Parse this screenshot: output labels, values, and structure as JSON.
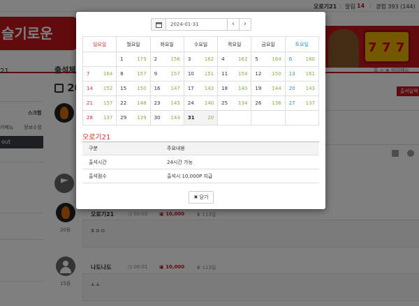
{
  "topbar": {
    "username": "오로기21",
    "alert_label": "알림",
    "alert_count": "14",
    "exp": "경험 393 (144)"
  },
  "banner": {
    "logo_text": "슬기로운"
  },
  "sidebar": {
    "name_fragment": "21",
    "menu_fragment": "스크랩",
    "link1": "키메뉴",
    "link2": "정보수정",
    "logout_fragment": "out",
    "red_fragment": ""
  },
  "page": {
    "title_fragment": "출석체",
    "date_fragment": "20",
    "breadcrumb": "홈 > ★ 마이메뉴",
    "attend_button": "출석달력"
  },
  "entries": [
    {
      "name": "오로기21",
      "time": "00:02",
      "points": "10,000",
      "rank_suffix": "113일",
      "text": "ㅊㅇㅇ",
      "rank": "20등"
    },
    {
      "name": "나도나도",
      "time": "00:01",
      "points": "10,000",
      "rank_suffix": "113일",
      "text": "ㅅㅅ",
      "rank": "15등"
    }
  ],
  "datepicker": {
    "value": "2024-01-31",
    "prev": "‹",
    "next": "›"
  },
  "calendar": {
    "weekdays": [
      "일요일",
      "월요일",
      "화요일",
      "수요일",
      "목요일",
      "금요일",
      "토요일"
    ],
    "weeks": [
      [
        {
          "d": "",
          "c": ""
        },
        {
          "d": "1",
          "c": "173"
        },
        {
          "d": "2",
          "c": "156"
        },
        {
          "d": "3",
          "c": "162"
        },
        {
          "d": "4",
          "c": "162"
        },
        {
          "d": "5",
          "c": "164"
        },
        {
          "d": "6",
          "c": "160"
        }
      ],
      [
        {
          "d": "7",
          "c": "164"
        },
        {
          "d": "8",
          "c": "157"
        },
        {
          "d": "9",
          "c": "157"
        },
        {
          "d": "10",
          "c": "151"
        },
        {
          "d": "11",
          "c": "154"
        },
        {
          "d": "12",
          "c": "150"
        },
        {
          "d": "13",
          "c": "161"
        }
      ],
      [
        {
          "d": "14",
          "c": "152"
        },
        {
          "d": "15",
          "c": "150"
        },
        {
          "d": "16",
          "c": "147"
        },
        {
          "d": "17",
          "c": "143"
        },
        {
          "d": "18",
          "c": "140"
        },
        {
          "d": "19",
          "c": "144"
        },
        {
          "d": "20",
          "c": "143"
        }
      ],
      [
        {
          "d": "21",
          "c": "157"
        },
        {
          "d": "22",
          "c": "148"
        },
        {
          "d": "23",
          "c": "143"
        },
        {
          "d": "24",
          "c": "140"
        },
        {
          "d": "25",
          "c": "134"
        },
        {
          "d": "26",
          "c": "136"
        },
        {
          "d": "27",
          "c": "137"
        }
      ],
      [
        {
          "d": "28",
          "c": "137"
        },
        {
          "d": "29",
          "c": "139"
        },
        {
          "d": "30",
          "c": "144"
        },
        {
          "d": "31",
          "c": "20"
        },
        {
          "d": "",
          "c": ""
        },
        {
          "d": "",
          "c": ""
        },
        {
          "d": "",
          "c": ""
        }
      ]
    ]
  },
  "info": {
    "title": "오로기21",
    "headers": [
      "구분",
      "주요내용"
    ],
    "rows": [
      [
        "출석시간",
        "24시간 가능"
      ],
      [
        "출석점수",
        "출석시 10,000P 지급"
      ]
    ]
  },
  "close_button": "닫기",
  "colors": {
    "accent_red": "#c5161d",
    "sunday": "#e03030",
    "saturday": "#2e8fd6",
    "count_green": "#7cb342"
  }
}
